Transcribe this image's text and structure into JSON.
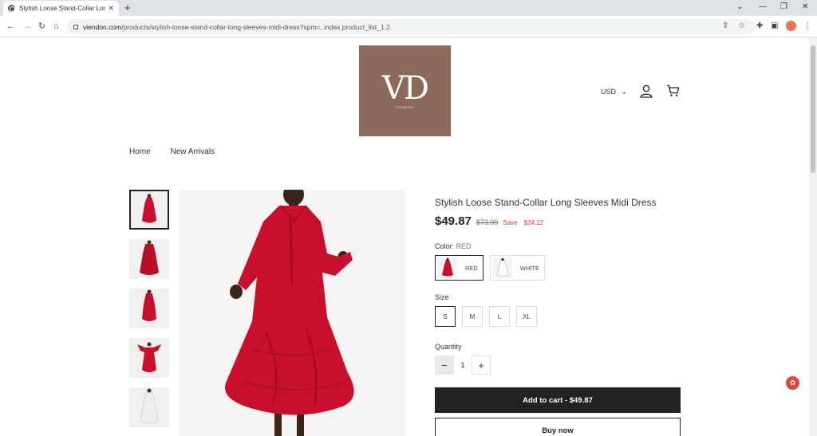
{
  "browser": {
    "tab_title": "Stylish Loose Stand-Collar Long Sl",
    "new_tab": "+",
    "url_domain": "viendon.com",
    "url_path": "/products/stylish-loose-stand-collar-long-sleeves-midi-dress?spm=..index.product_list_1.2",
    "window_controls": [
      "⌄",
      "—",
      "❐",
      "✕"
    ]
  },
  "header": {
    "logo_mark": "VD",
    "logo_brand": "VIENDON",
    "currency": "USD",
    "nav": [
      "Home",
      "New Arrivals"
    ]
  },
  "product": {
    "title": "Stylish Loose Stand-Collar Long Sleeves Midi Dress",
    "price": "$49.87",
    "compare_price": "$73.99",
    "save_label": "Save",
    "save_amount": "$24.12",
    "color_label": "Color:",
    "color_selected": "RED",
    "colors": [
      "RED",
      "WHITE"
    ],
    "size_label": "Size",
    "sizes": [
      "S",
      "M",
      "L",
      "XL"
    ],
    "quantity_label": "Quantity",
    "quantity": "1",
    "qty_minus": "−",
    "qty_plus": "+",
    "add_to_cart": "Add to cart - $49.87",
    "buy_now": "Buy now"
  },
  "colors": {
    "logo_bg": "#8c6a5a",
    "dress_red": "#c8102e",
    "sale_red": "#e03a3a",
    "button_dark": "#222222"
  }
}
